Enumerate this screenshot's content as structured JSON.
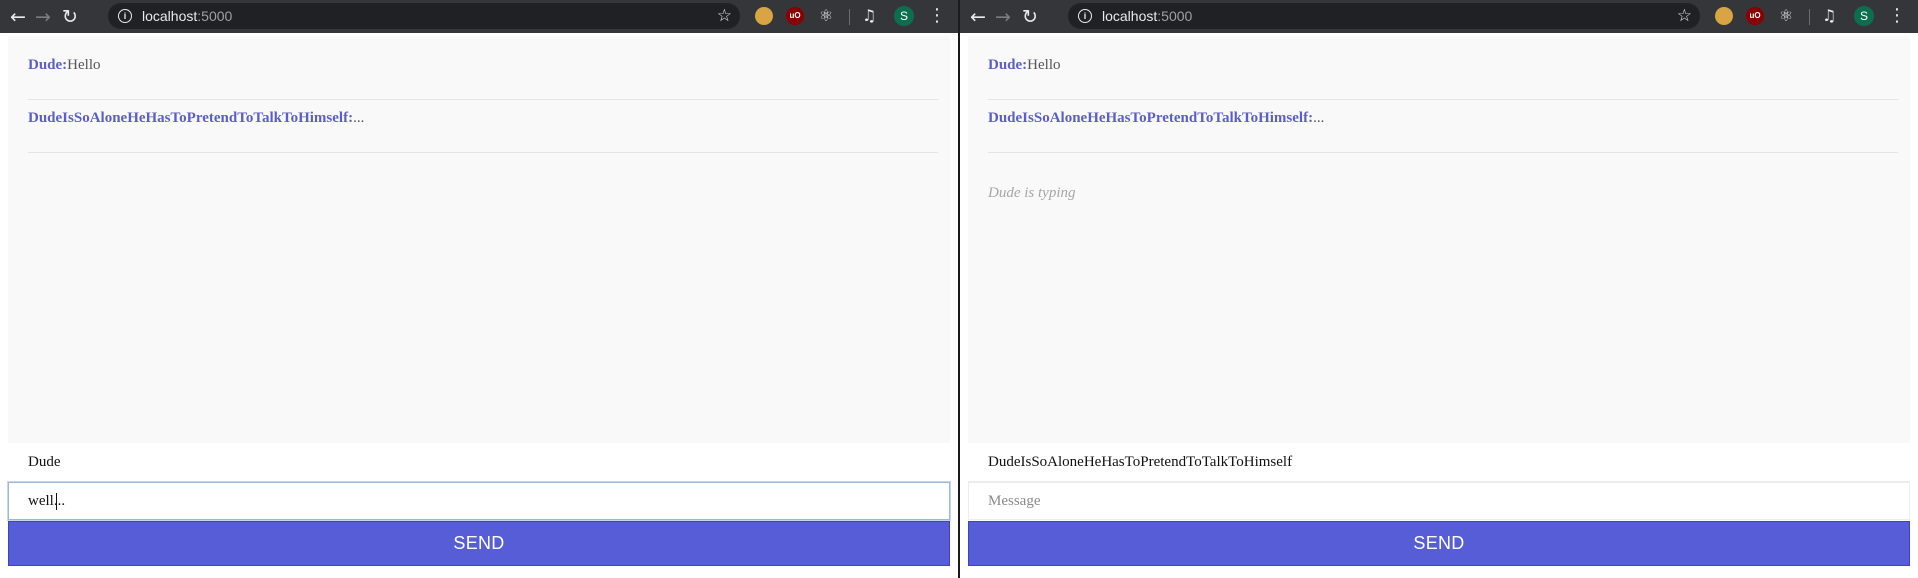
{
  "browser": {
    "url_host": "localhost",
    "url_port": ":5000",
    "profile_initial": "S",
    "ext_labels": [
      "",
      "uO",
      "⚛"
    ]
  },
  "left_window": {
    "messages": [
      {
        "author": "Dude:",
        "text": "Hello"
      },
      {
        "author": "DudeIsSoAloneHeHasToPretendToTalkToHimself:",
        "text": "..."
      }
    ],
    "username": "Dude",
    "input_value": "well...",
    "input_placeholder": "Message",
    "send_label": "SEND"
  },
  "right_window": {
    "messages": [
      {
        "author": "Dude:",
        "text": "Hello"
      },
      {
        "author": "DudeIsSoAloneHeHasToPretendToTalkToHimself:",
        "text": "..."
      }
    ],
    "typing_indicator": "Dude is typing",
    "username": "DudeIsSoAloneHeHasToPretendToTalkToHimself",
    "input_value": "",
    "input_placeholder": "Message",
    "send_label": "SEND"
  },
  "colors": {
    "author": "#5b5fc7",
    "send_button": "#565dd6",
    "chat_background": "#f9f9f9",
    "browser_toolbar": "#35363a"
  }
}
